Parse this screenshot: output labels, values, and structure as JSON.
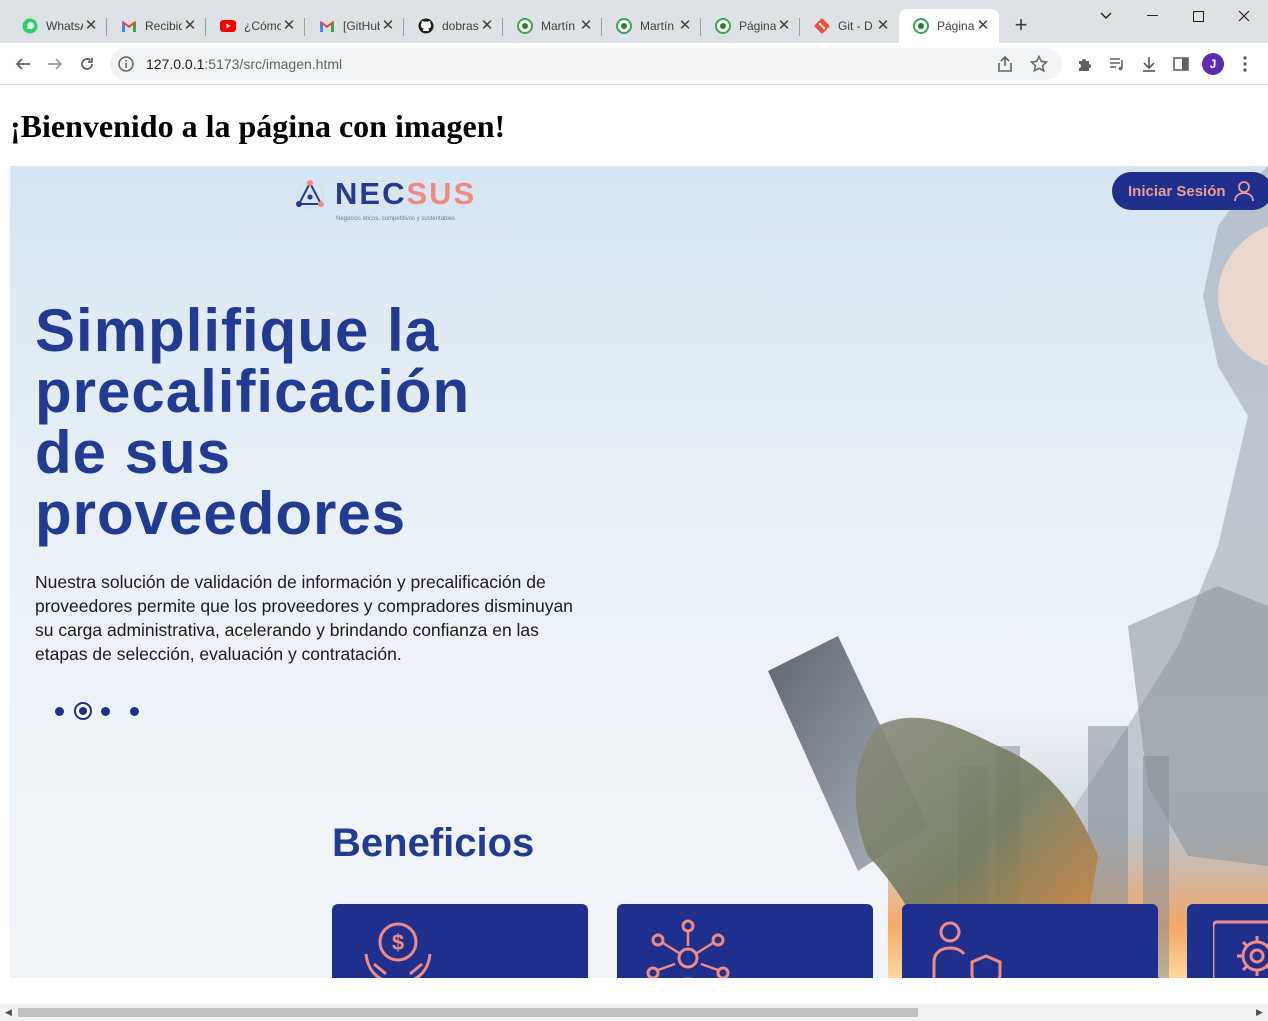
{
  "browser": {
    "tabs": [
      {
        "title": "WhatsApp",
        "icon": "whatsapp-icon"
      },
      {
        "title": "Recibidos",
        "icon": "gmail-icon"
      },
      {
        "title": "¿Cómo",
        "icon": "youtube-icon"
      },
      {
        "title": "[GitHub]",
        "icon": "gmail-icon"
      },
      {
        "title": "dobras",
        "icon": "github-icon"
      },
      {
        "title": "Martín",
        "icon": "vite-globe-icon"
      },
      {
        "title": "Martín",
        "icon": "vite-globe-icon"
      },
      {
        "title": "Página",
        "icon": "vite-globe-icon"
      },
      {
        "title": "Git - D",
        "icon": "git-icon"
      },
      {
        "title": "Página",
        "icon": "vite-globe-icon",
        "active": true
      }
    ],
    "address": {
      "host": "127.0.0.1",
      "rest": ":5173/src/imagen.html"
    },
    "profile_initial": "J"
  },
  "page": {
    "heading": "¡Bienvenido a la página con imagen!",
    "hero": {
      "logo": {
        "word_a": "NEC",
        "word_b": "SUS",
        "tagline": "Negocios éticos, competitivos y sustentables"
      },
      "login_label": "Iniciar Sesión",
      "title_lines": [
        "Simplifique la",
        "precalificación",
        "de sus",
        "proveedores"
      ],
      "body": "Nuestra solución de validación de información y precalificación de proveedores permite que los proveedores y compradores disminuyan su carga administrativa, acelerando y brindando confianza en las etapas de selección, evaluación y contratación.",
      "carousel": {
        "count": 4,
        "active": 2
      },
      "benefits_title": "Beneficios",
      "benefit_icons": [
        "money-hands-icon",
        "network-people-icon",
        "person-shield-icon",
        "settings-gear-icon"
      ]
    }
  },
  "colors": {
    "brand_blue": "#213a92",
    "brand_coral": "#ef8a84",
    "card_blue": "#1f2f8e"
  }
}
